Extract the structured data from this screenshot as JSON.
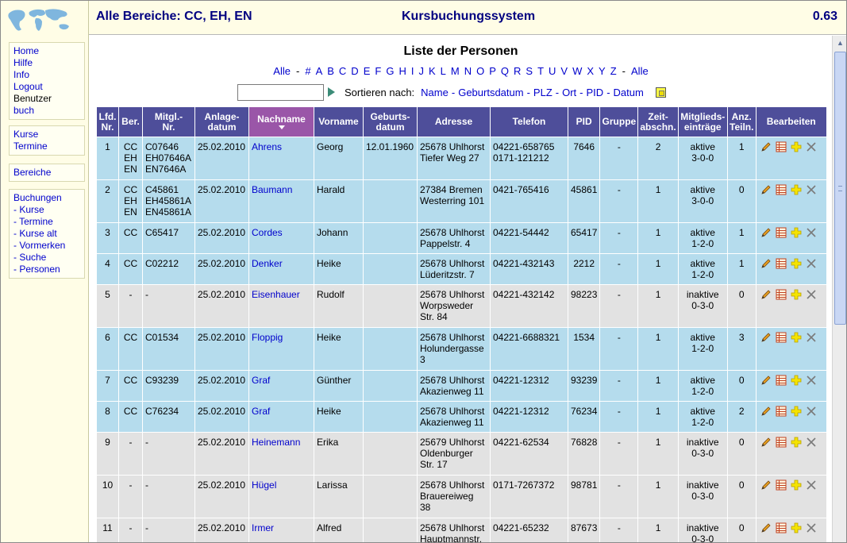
{
  "header": {
    "scope": "Alle Bereiche: CC, EH, EN",
    "title": "Kursbuchungssystem",
    "version": "0.63"
  },
  "logo_icon": "world-map-icon",
  "menu": {
    "group1": [
      {
        "label": "Home",
        "link": true
      },
      {
        "label": "Hilfe",
        "link": true
      },
      {
        "label": "Info",
        "link": true
      },
      {
        "label": "Logout",
        "link": true
      },
      {
        "label": "Benutzer",
        "link": false
      },
      {
        "label": "buch",
        "link": true
      }
    ],
    "group2": [
      {
        "label": "Kurse",
        "link": true
      },
      {
        "label": "Termine",
        "link": true
      }
    ],
    "group3": [
      {
        "label": "Bereiche",
        "link": true
      }
    ],
    "group4": [
      {
        "label": "Buchungen",
        "link": true
      },
      {
        "label": "- Kurse",
        "link": true
      },
      {
        "label": "- Termine",
        "link": true
      },
      {
        "label": "- Kurse alt",
        "link": true
      },
      {
        "label": "- Vormerken",
        "link": true
      },
      {
        "label": "- Suche",
        "link": true
      },
      {
        "label": "- Personen",
        "link": true
      }
    ]
  },
  "page_title": "Liste der Personen",
  "alphabet": {
    "first": "Alle",
    "letters": [
      "#",
      "A",
      "B",
      "C",
      "D",
      "E",
      "F",
      "G",
      "H",
      "I",
      "J",
      "K",
      "L",
      "M",
      "N",
      "O",
      "P",
      "Q",
      "R",
      "S",
      "T",
      "U",
      "V",
      "W",
      "X",
      "Y",
      "Z"
    ],
    "last": "Alle"
  },
  "search": {
    "value": "",
    "placeholder": ""
  },
  "sort": {
    "label": "Sortieren nach:",
    "options": [
      "Name",
      "Geburtsdatum",
      "PLZ",
      "Ort",
      "PID",
      "Datum"
    ]
  },
  "table": {
    "columns": [
      [
        "Lfd.",
        "Nr."
      ],
      [
        "Ber."
      ],
      [
        "Mitgl.-",
        "Nr."
      ],
      [
        "Anlage-",
        "datum"
      ],
      [
        "Nachname"
      ],
      [
        "Vorname"
      ],
      [
        "Geburts-",
        "datum"
      ],
      [
        "Adresse"
      ],
      [
        "Telefon"
      ],
      [
        "PID"
      ],
      [
        "Gruppe"
      ],
      [
        "Zeit-",
        "abschn."
      ],
      [
        "Mitglieds-",
        "einträge"
      ],
      [
        "Anz.",
        "Teiln."
      ],
      [
        "Bearbeiten"
      ]
    ],
    "rows": [
      {
        "nr": "1",
        "ber": [
          "CC",
          "EH",
          "EN"
        ],
        "mitgl": [
          "C07646",
          "EH07646A",
          "EN7646A"
        ],
        "anlage": "25.02.2010",
        "nachname": "Ahrens",
        "vorname": "Georg",
        "geburt": "12.01.1960",
        "adresse": [
          "25678 Uhlhorst",
          "Tiefer Weg 27"
        ],
        "telefon": [
          "04221-658765",
          "0171-121212"
        ],
        "pid": "7646",
        "gruppe": "-",
        "zeit": "2",
        "status": [
          "aktive",
          "3-0-0"
        ],
        "anz": "1",
        "highlight": "blue"
      },
      {
        "nr": "2",
        "ber": [
          "CC",
          "EH",
          "EN"
        ],
        "mitgl": [
          "C45861",
          "EH45861A",
          "EN45861A"
        ],
        "anlage": "25.02.2010",
        "nachname": "Baumann",
        "vorname": "Harald",
        "geburt": "",
        "adresse": [
          "27384 Bremen",
          "Westerring 101"
        ],
        "telefon": [
          "0421-765416"
        ],
        "pid": "45861",
        "gruppe": "-",
        "zeit": "1",
        "status": [
          "aktive",
          "3-0-0"
        ],
        "anz": "0",
        "highlight": "blue"
      },
      {
        "nr": "3",
        "ber": [
          "CC"
        ],
        "mitgl": [
          "C65417"
        ],
        "anlage": "25.02.2010",
        "nachname": "Cordes",
        "vorname": "Johann",
        "geburt": "",
        "adresse": [
          "25678 Uhlhorst",
          "Pappelstr. 4"
        ],
        "telefon": [
          "04221-54442"
        ],
        "pid": "65417",
        "gruppe": "-",
        "zeit": "1",
        "status": [
          "aktive",
          "1-2-0"
        ],
        "anz": "1",
        "highlight": "blue"
      },
      {
        "nr": "4",
        "ber": [
          "CC"
        ],
        "mitgl": [
          "C02212"
        ],
        "anlage": "25.02.2010",
        "nachname": "Denker",
        "vorname": "Heike",
        "geburt": "",
        "adresse": [
          "25678 Uhlhorst",
          "Lüderitzstr. 7"
        ],
        "telefon": [
          "04221-432143"
        ],
        "pid": "2212",
        "gruppe": "-",
        "zeit": "1",
        "status": [
          "aktive",
          "1-2-0"
        ],
        "anz": "1",
        "highlight": "blue"
      },
      {
        "nr": "5",
        "ber": [
          "-"
        ],
        "mitgl": [
          "-"
        ],
        "anlage": "25.02.2010",
        "nachname": "Eisenhauer",
        "vorname": "Rudolf",
        "geburt": "",
        "adresse": [
          "25678 Uhlhorst",
          "Worpsweder",
          "Str. 84"
        ],
        "telefon": [
          "04221-432142"
        ],
        "pid": "98223",
        "gruppe": "-",
        "zeit": "1",
        "status": [
          "inaktive",
          "0-3-0"
        ],
        "anz": "0",
        "highlight": "grey"
      },
      {
        "nr": "6",
        "ber": [
          "CC"
        ],
        "mitgl": [
          "C01534"
        ],
        "anlage": "25.02.2010",
        "nachname": "Floppig",
        "vorname": "Heike",
        "geburt": "",
        "adresse": [
          "25678 Uhlhorst",
          "Holundergasse",
          "3"
        ],
        "telefon": [
          "04221-6688321"
        ],
        "pid": "1534",
        "gruppe": "-",
        "zeit": "1",
        "status": [
          "aktive",
          "1-2-0"
        ],
        "anz": "3",
        "highlight": "blue"
      },
      {
        "nr": "7",
        "ber": [
          "CC"
        ],
        "mitgl": [
          "C93239"
        ],
        "anlage": "25.02.2010",
        "nachname": "Graf",
        "vorname": "Günther",
        "geburt": "",
        "adresse": [
          "25678 Uhlhorst",
          "Akazienweg 11"
        ],
        "telefon": [
          "04221-12312"
        ],
        "pid": "93239",
        "gruppe": "-",
        "zeit": "1",
        "status": [
          "aktive",
          "1-2-0"
        ],
        "anz": "0",
        "highlight": "blue"
      },
      {
        "nr": "8",
        "ber": [
          "CC"
        ],
        "mitgl": [
          "C76234"
        ],
        "anlage": "25.02.2010",
        "nachname": "Graf",
        "vorname": "Heike",
        "geburt": "",
        "adresse": [
          "25678 Uhlhorst",
          "Akazienweg 11"
        ],
        "telefon": [
          "04221-12312"
        ],
        "pid": "76234",
        "gruppe": "-",
        "zeit": "1",
        "status": [
          "aktive",
          "1-2-0"
        ],
        "anz": "2",
        "highlight": "blue"
      },
      {
        "nr": "9",
        "ber": [
          "-"
        ],
        "mitgl": [
          "-"
        ],
        "anlage": "25.02.2010",
        "nachname": "Heinemann",
        "vorname": "Erika",
        "geburt": "",
        "adresse": [
          "25679 Uhlhorst",
          "Oldenburger",
          "Str. 17"
        ],
        "telefon": [
          "04221-62534"
        ],
        "pid": "76828",
        "gruppe": "-",
        "zeit": "1",
        "status": [
          "inaktive",
          "0-3-0"
        ],
        "anz": "0",
        "highlight": "grey"
      },
      {
        "nr": "10",
        "ber": [
          "-"
        ],
        "mitgl": [
          "-"
        ],
        "anlage": "25.02.2010",
        "nachname": "Hügel",
        "vorname": "Larissa",
        "geburt": "",
        "adresse": [
          "25678 Uhlhorst",
          "Brauereiweg",
          "38"
        ],
        "telefon": [
          "0171-7267372"
        ],
        "pid": "98781",
        "gruppe": "-",
        "zeit": "1",
        "status": [
          "inaktive",
          "0-3-0"
        ],
        "anz": "0",
        "highlight": "grey"
      },
      {
        "nr": "11",
        "ber": [
          "-"
        ],
        "mitgl": [
          "-"
        ],
        "anlage": "25.02.2010",
        "nachname": "Irmer",
        "vorname": "Alfred",
        "geburt": "",
        "adresse": [
          "25678 Uhlhorst",
          "Hauptmannstr."
        ],
        "telefon": [
          "04221-65232"
        ],
        "pid": "87673",
        "gruppe": "-",
        "zeit": "1",
        "status": [
          "inaktive",
          "0-3-0"
        ],
        "anz": "0",
        "highlight": "grey"
      }
    ],
    "actions": [
      "edit-pencil-icon",
      "list-icon",
      "add-plus-icon",
      "delete-x-icon"
    ]
  },
  "colors": {
    "header_bg": "#fffde6",
    "table_head": "#4e4e9a",
    "sorted_head": "#9a56a8",
    "row_active": "#b5dced",
    "row_inactive": "#e2e2e2",
    "link": "#0000cc",
    "title_blue": "#000080"
  }
}
